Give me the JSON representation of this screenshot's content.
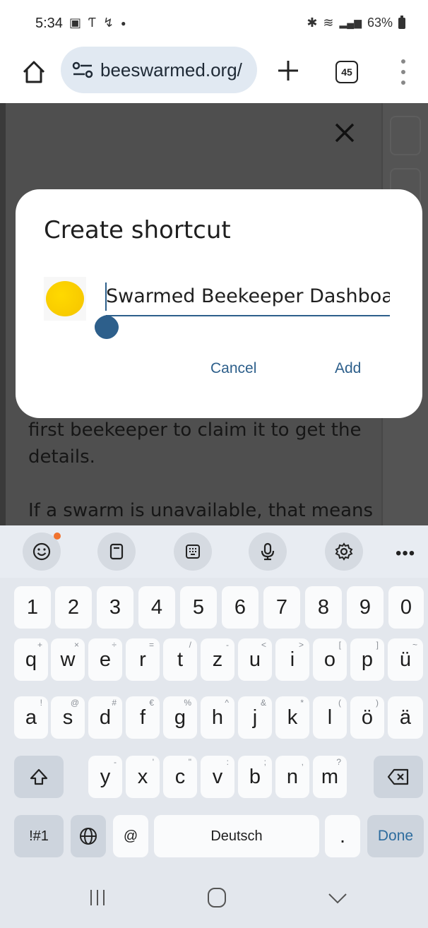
{
  "status_bar": {
    "time": "5:34",
    "battery": "63%"
  },
  "browser": {
    "url": "beeswarmed.org/",
    "tab_count": "45"
  },
  "page": {
    "line1": "first beekeeper to claim it to get the",
    "line2": "details.",
    "line3": "If a swarm is unavailable, that means"
  },
  "dialog": {
    "title": "Create shortcut",
    "name_value": "Swarmed Beekeeper Dashboard",
    "cancel_label": "Cancel",
    "add_label": "Add"
  },
  "keyboard": {
    "numbers": [
      "1",
      "2",
      "3",
      "4",
      "5",
      "6",
      "7",
      "8",
      "9",
      "0"
    ],
    "row1": [
      "q",
      "w",
      "e",
      "r",
      "t",
      "z",
      "u",
      "i",
      "o",
      "p",
      "ü"
    ],
    "row1_sup": [
      "+",
      "×",
      "÷",
      "=",
      "/",
      "-",
      "<",
      ">",
      "[",
      "]",
      "~"
    ],
    "row2": [
      "a",
      "s",
      "d",
      "f",
      "g",
      "h",
      "j",
      "k",
      "l",
      "ö",
      "ä"
    ],
    "row2_sup": [
      "!",
      "@",
      "#",
      "€",
      "%",
      "^",
      "&",
      "*",
      "(",
      ")",
      ""
    ],
    "row3": [
      "y",
      "x",
      "c",
      "v",
      "b",
      "n",
      "m"
    ],
    "row3_sup": [
      "-",
      "'",
      "\"",
      ":",
      ";",
      ",",
      "?"
    ],
    "symbols_label": "!#1",
    "at_label": "@",
    "space_label": "Deutsch",
    "period_label": ".",
    "done_label": "Done"
  },
  "colors": {
    "accent": "#2d5f8b",
    "scrim": "#4f4f4f",
    "favicon": "#f5c400",
    "keyboard_bg": "#e3e7ed"
  },
  "icons": [
    "home-icon",
    "site-settings-icon",
    "plus-icon",
    "tab-switcher-icon",
    "more-vert-icon",
    "close-icon",
    "emoji-icon",
    "clipboard-icon",
    "keypad-icon",
    "mic-icon",
    "settings-icon",
    "shift-icon",
    "backspace-icon",
    "globe-icon",
    "recents-icon",
    "home-nav-icon",
    "back-nav-icon"
  ]
}
